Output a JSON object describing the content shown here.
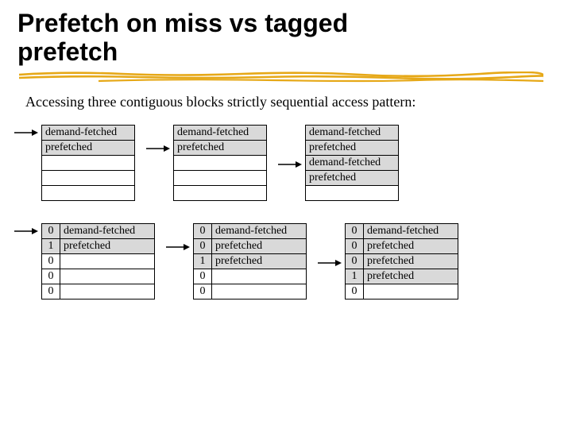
{
  "title_line1": "Prefetch on miss vs tagged",
  "title_line2": "prefetch",
  "subtitle": "Accessing three contiguous blocks strictly sequential access pattern:",
  "labels": {
    "demand": "demand-fetched",
    "prefetched": "prefetched"
  },
  "row_top": {
    "caches": [
      {
        "arrow_row": 0,
        "cells": [
          "demand",
          "prefetched",
          "",
          "",
          ""
        ],
        "gray": [
          0,
          1
        ]
      },
      {
        "arrow_row": 1,
        "cells": [
          "demand",
          "prefetched",
          "",
          "",
          ""
        ],
        "gray": [
          0,
          1
        ]
      },
      {
        "arrow_row": 2,
        "cells": [
          "demand",
          "prefetched",
          "demand",
          "prefetched",
          ""
        ],
        "gray": [
          0,
          1,
          2,
          3
        ]
      }
    ]
  },
  "row_bot": {
    "caches": [
      {
        "arrow_row": 0,
        "tags": [
          "0",
          "1",
          "0",
          "0",
          "0"
        ],
        "cells": [
          "demand",
          "prefetched",
          "",
          "",
          ""
        ],
        "gray": [
          0,
          1
        ]
      },
      {
        "arrow_row": 1,
        "tags": [
          "0",
          "0",
          "1",
          "0",
          "0"
        ],
        "cells": [
          "demand",
          "prefetched",
          "prefetched",
          "",
          ""
        ],
        "gray": [
          0,
          1,
          2
        ]
      },
      {
        "arrow_row": 2,
        "tags": [
          "0",
          "0",
          "0",
          "1",
          "0"
        ],
        "cells": [
          "demand",
          "prefetched",
          "prefetched",
          "prefetched",
          ""
        ],
        "gray": [
          0,
          1,
          2,
          3
        ]
      }
    ]
  }
}
